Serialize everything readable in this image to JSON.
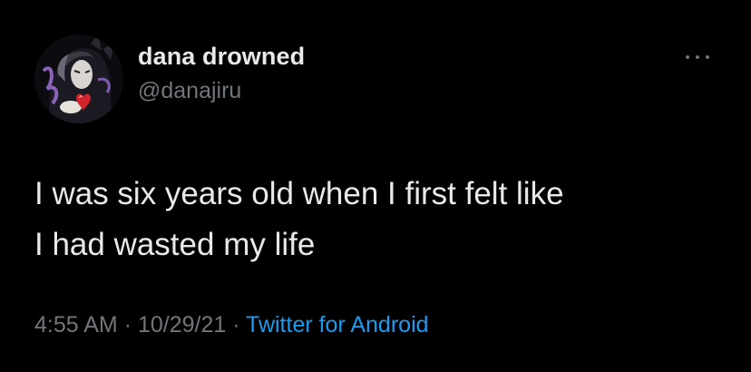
{
  "user": {
    "display_name": "dana drowned",
    "handle": "@danajiru",
    "avatar_icon": "profile-avatar"
  },
  "tweet": {
    "text": "I was six years old when I first felt like\nI had wasted my life",
    "time": "4:55 AM",
    "separator": " · ",
    "date": "10/29/21",
    "source": "Twitter for Android"
  },
  "actions": {
    "more_icon": "more-options-icon"
  },
  "colors": {
    "background": "#000000",
    "primary_text": "#e7e9ea",
    "secondary_text": "#71767b",
    "link": "#1d9bf0"
  }
}
